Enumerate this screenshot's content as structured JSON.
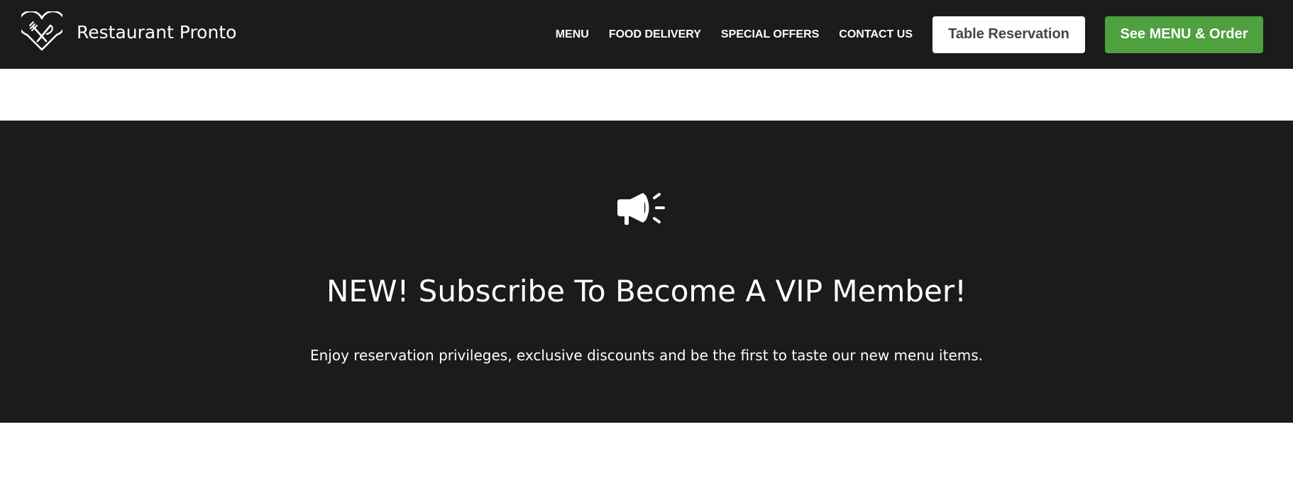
{
  "brand": {
    "name": "Restaurant Pronto",
    "logo_icon": "fork-knife-heart-icon"
  },
  "nav": {
    "items": [
      {
        "label": "MENU"
      },
      {
        "label": "FOOD DELIVERY"
      },
      {
        "label": "SPECIAL OFFERS"
      },
      {
        "label": "CONTACT US"
      }
    ],
    "reserve_label": "Table Reservation",
    "order_label": "See MENU & Order"
  },
  "hero": {
    "icon": "megaphone-icon",
    "title": "NEW! Subscribe To Become A VIP Member!",
    "subtitle": "Enjoy reservation privileges, exclusive discounts and be the first to taste our new menu items."
  },
  "colors": {
    "dark_bg": "#1b1b1b",
    "accent_green": "#4fa03f",
    "white": "#ffffff"
  }
}
